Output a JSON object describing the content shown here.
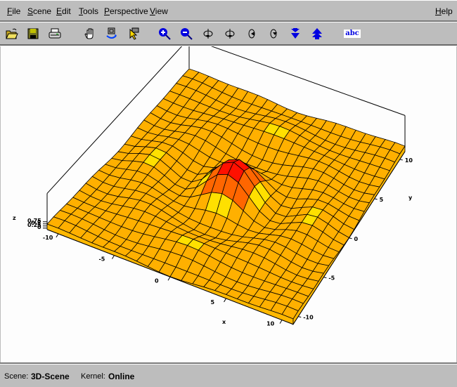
{
  "menubar": {
    "items": [
      {
        "label": "File",
        "underline": "F",
        "rest": "ile"
      },
      {
        "label": "Scene",
        "underline": "S",
        "rest": "cene"
      },
      {
        "label": "Edit",
        "underline": "E",
        "rest": "dit"
      },
      {
        "label": "Tools",
        "underline": "T",
        "rest": "ools"
      },
      {
        "label": "Perspective",
        "underline": "P",
        "rest": "erspective"
      },
      {
        "label": "View",
        "underline": "V",
        "rest": "iew"
      }
    ],
    "help": {
      "label": "Help",
      "underline": "H",
      "rest": "elp"
    }
  },
  "toolbar": {
    "buttons": [
      {
        "name": "open-file",
        "icon": "folder-open-icon"
      },
      {
        "name": "save",
        "icon": "floppy-disk-icon"
      },
      {
        "name": "print",
        "icon": "printer-icon"
      },
      {
        "name": "pan",
        "icon": "hand-icon"
      },
      {
        "name": "rotate-view",
        "icon": "rotate-view-icon"
      },
      {
        "name": "select",
        "icon": "pointer-icon"
      },
      {
        "name": "zoom-in",
        "icon": "zoom-in-icon"
      },
      {
        "name": "zoom-out",
        "icon": "zoom-out-icon"
      },
      {
        "name": "rotate-left",
        "icon": "rotate-left-icon"
      },
      {
        "name": "rotate-right",
        "icon": "rotate-right-icon"
      },
      {
        "name": "tilt-up",
        "icon": "tilt-up-icon"
      },
      {
        "name": "tilt-down",
        "icon": "tilt-down-icon"
      },
      {
        "name": "move-down",
        "icon": "arrow-down-icon"
      },
      {
        "name": "move-up",
        "icon": "arrow-up-icon"
      },
      {
        "name": "labels",
        "icon": "text-label-icon",
        "text": "abc"
      }
    ]
  },
  "colors": {
    "surface_low": "#ffb000",
    "surface_mid": "#ffe000",
    "surface_high": "#ff6600",
    "surface_peak": "#ff1000",
    "toolbar_icon_blue": "#0000e0"
  },
  "plot": {
    "axes": {
      "x": {
        "label": "x",
        "ticks": [
          "-10",
          "-5",
          "0",
          "5",
          "10"
        ]
      },
      "y": {
        "label": "y",
        "ticks": [
          "-10",
          "-5",
          "0",
          "5",
          "10"
        ]
      },
      "z": {
        "label": "z",
        "ticks": [
          "0",
          "0.25",
          "0.5",
          "0.75"
        ]
      }
    }
  },
  "statusbar": {
    "scene_label": "Scene:",
    "scene_value": "3D-Scene",
    "kernel_label": "Kernel:",
    "kernel_value": "Online"
  }
}
